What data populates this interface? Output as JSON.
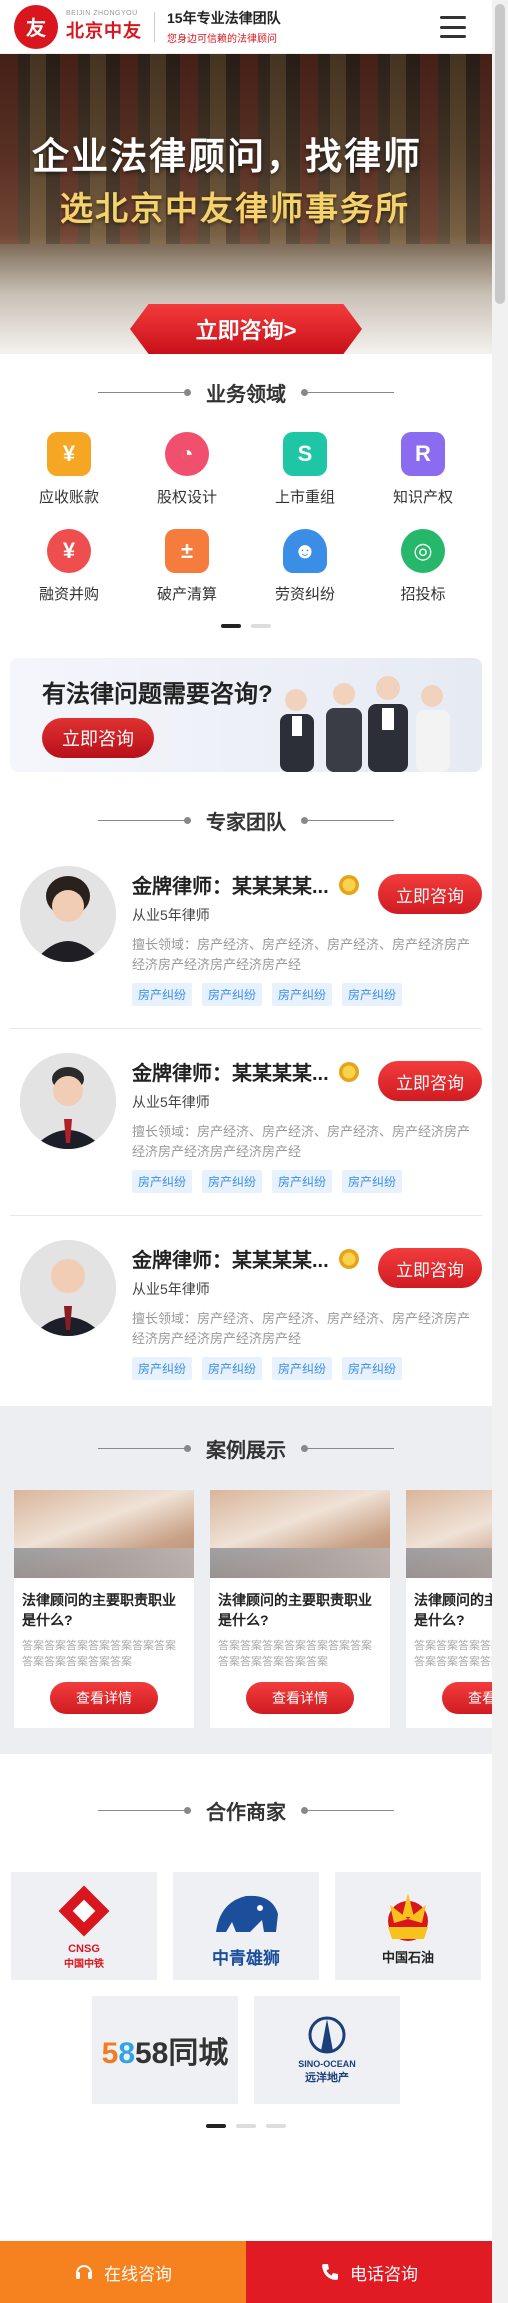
{
  "header": {
    "logo_en": "BEIJIN ZHONGYOU",
    "logo_cn": "北京中友",
    "slogan_title": "15年专业法律团队",
    "slogan_sub": "您身边可信赖的法律顾问",
    "menu_icon": "hamburger-menu-icon"
  },
  "banner": {
    "line1": "企业法律顾问，找律师",
    "line2": "选北京中友律师事务所",
    "cta": "立即咨询>"
  },
  "business": {
    "title": "业务领域",
    "items": [
      {
        "label": "应收账款",
        "icon": "yuan-icon",
        "color": "#f5a623"
      },
      {
        "label": "股权设计",
        "icon": "pie-chart-icon",
        "color": "#f0506e"
      },
      {
        "label": "上市重组",
        "icon": "restructure-icon",
        "color": "#1ec6a5"
      },
      {
        "label": "知识产权",
        "icon": "shield-r-icon",
        "color": "#8b6cf0"
      },
      {
        "label": "融资并购",
        "icon": "money-bag-icon",
        "color": "#ef4e4e"
      },
      {
        "label": "破产清算",
        "icon": "calculator-icon",
        "color": "#f57c3c"
      },
      {
        "label": "劳资纠纷",
        "icon": "worker-icon",
        "color": "#3a8ee6"
      },
      {
        "label": "招投标",
        "icon": "target-icon",
        "color": "#25b86a"
      }
    ]
  },
  "consult_banner": {
    "question": "有法律问题需要咨询?",
    "button": "立即咨询"
  },
  "experts": {
    "title": "专家团队",
    "items": [
      {
        "name": "金牌律师：某某某某...",
        "years": "从业5年律师",
        "desc": "擅长领域：房产经济、房产经济、房产经济、房产经济房产经济房产经济房产经济房产经",
        "tags": [
          "房产纠纷",
          "房产纠纷",
          "房产纠纷",
          "房产纠纷"
        ],
        "button": "立即咨询"
      },
      {
        "name": "金牌律师：某某某某...",
        "years": "从业5年律师",
        "desc": "擅长领域：房产经济、房产经济、房产经济、房产经济房产经济房产经济房产经济房产经",
        "tags": [
          "房产纠纷",
          "房产纠纷",
          "房产纠纷",
          "房产纠纷"
        ],
        "button": "立即咨询"
      },
      {
        "name": "金牌律师：某某某某...",
        "years": "从业5年律师",
        "desc": "擅长领域：房产经济、房产经济、房产经济、房产经济房产经济房产经济房产经济房产经",
        "tags": [
          "房产纠纷",
          "房产纠纷",
          "房产纠纷",
          "房产纠纷"
        ],
        "button": "立即咨询"
      }
    ]
  },
  "cases": {
    "title": "案例展示",
    "items": [
      {
        "title": "法律顾问的主要职责职业是什么?",
        "desc": "答案答案答案答案答案答案答案答案答案答案答案答案",
        "button": "查看详情"
      },
      {
        "title": "法律顾问的主要职责职业是什么?",
        "desc": "答案答案答案答案答案答案答案答案答案答案答案答案",
        "button": "查看详情"
      },
      {
        "title": "法律顾问的主要职责职业是什么?",
        "desc": "答案答案答案答案答案答案答案答案答案答案答案答案",
        "button": "查看详情"
      }
    ]
  },
  "partners": {
    "title": "合作商家",
    "items": [
      {
        "name": "中国中铁",
        "brand": "CNSG",
        "color": "#d9161e"
      },
      {
        "name": "中青雄狮",
        "color": "#1b4f9c"
      },
      {
        "name": "中国石油",
        "color": "#d9161e"
      },
      {
        "name": "58同城",
        "color": "#333333"
      },
      {
        "name": "远洋地产",
        "brand": "SINO-OCEAN",
        "color": "#1b3f7a"
      }
    ]
  },
  "bottom_bar": {
    "online": "在线咨询",
    "online_icon": "headset-icon",
    "phone": "电话咨询",
    "phone_icon": "phone-icon"
  }
}
